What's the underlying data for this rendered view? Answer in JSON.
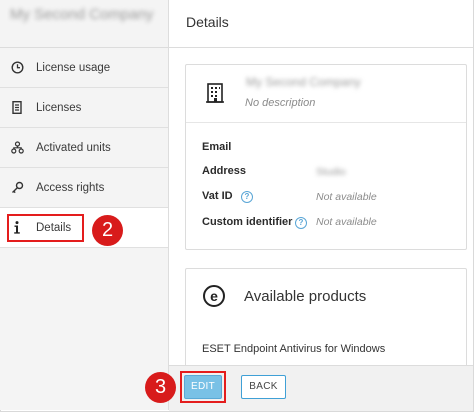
{
  "sidebar": {
    "company_name": "My Second Company",
    "items": [
      {
        "label": "License usage",
        "icon": "clock-icon"
      },
      {
        "label": "Licenses",
        "icon": "license-list-icon"
      },
      {
        "label": "Activated units",
        "icon": "hierarchy-icon"
      },
      {
        "label": "Access rights",
        "icon": "key-icon"
      },
      {
        "label": "Details",
        "icon": "info-icon",
        "active": true
      }
    ]
  },
  "main": {
    "title": "Details",
    "company_card": {
      "name": "My Second Company",
      "description": "No description",
      "fields": [
        {
          "label": "Email",
          "value": ""
        },
        {
          "label": "Address",
          "value": "Studio"
        },
        {
          "label": "Vat ID",
          "value": "Not available"
        },
        {
          "label": "Custom identifier",
          "value": "Not available"
        }
      ]
    },
    "products_card": {
      "title": "Available products",
      "items": [
        "ESET Endpoint Antivirus for Windows"
      ]
    }
  },
  "footer": {
    "edit_label": "EDIT",
    "back_label": "BACK"
  },
  "callouts": [
    "2",
    "3"
  ],
  "colors": {
    "highlight_red": "#e41d1d",
    "callout_red": "#d81b1b",
    "primary_button": "#79c1e6",
    "help_blue": "#5aa6d6"
  }
}
